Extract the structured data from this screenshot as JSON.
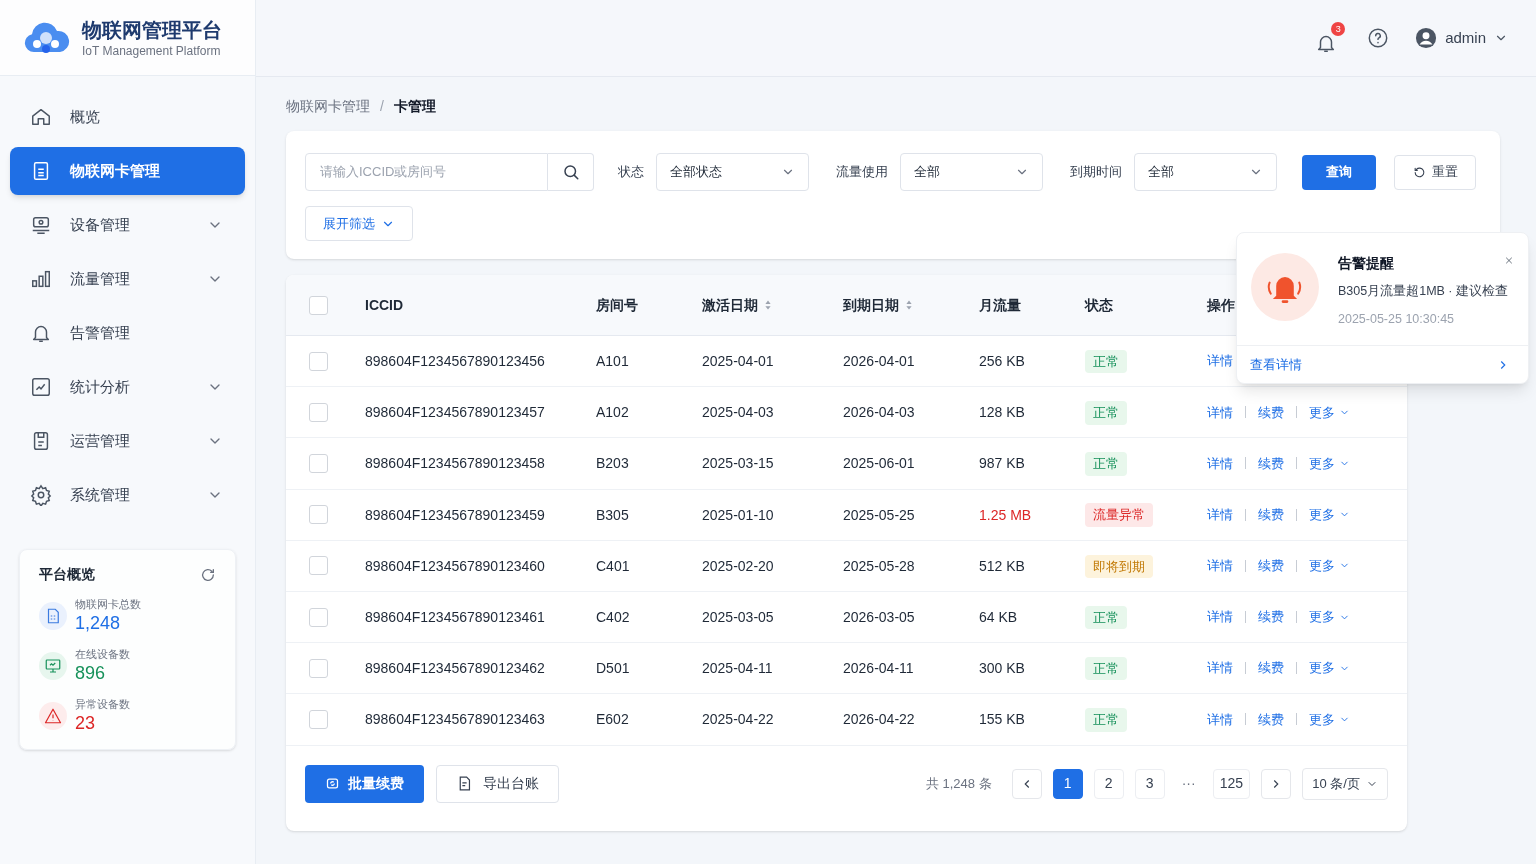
{
  "brand": {
    "title": "物联网管理平台",
    "subtitle": "IoT Management Platform"
  },
  "topbar": {
    "notification_count": "3",
    "user": "admin"
  },
  "sidebar": {
    "items": [
      {
        "label": "概览",
        "selected": false,
        "expandable": false
      },
      {
        "label": "物联网卡管理",
        "selected": true,
        "expandable": false
      },
      {
        "label": "设备管理",
        "selected": false,
        "expandable": true
      },
      {
        "label": "流量管理",
        "selected": false,
        "expandable": true
      },
      {
        "label": "告警管理",
        "selected": false,
        "expandable": false
      },
      {
        "label": "统计分析",
        "selected": false,
        "expandable": true
      },
      {
        "label": "运营管理",
        "selected": false,
        "expandable": true
      },
      {
        "label": "系统管理",
        "selected": false,
        "expandable": true
      }
    ]
  },
  "overview": {
    "title": "平台概览",
    "stats": [
      {
        "kind": "cards",
        "label": "物联网卡总数",
        "value": "1,248"
      },
      {
        "kind": "online",
        "label": "在线设备数",
        "value": "896"
      },
      {
        "kind": "abnormal",
        "label": "异常设备数",
        "value": "23"
      }
    ]
  },
  "breadcrumb": {
    "items": [
      "物联网卡管理",
      "卡管理"
    ],
    "separator": "/"
  },
  "filters": {
    "search_placeholder": "请输入ICCID或房间号",
    "selects": [
      {
        "label": "状态",
        "value": "全部状态"
      },
      {
        "label": "流量使用",
        "value": "全部"
      },
      {
        "label": "到期时间",
        "value": "全部"
      }
    ],
    "query_button": "查询",
    "reset_button": "重置",
    "expand_button": "展开筛选"
  },
  "table": {
    "header_checked": false,
    "columns": [
      {
        "label": "ICCID",
        "sortable": false
      },
      {
        "label": "房间号",
        "sortable": false
      },
      {
        "label": "激活日期",
        "sortable": true
      },
      {
        "label": "到期日期",
        "sortable": true
      },
      {
        "label": "月流量",
        "sortable": false
      },
      {
        "label": "状态",
        "sortable": false
      },
      {
        "label": "操作"
      }
    ],
    "rows": [
      {
        "checked": false,
        "iccid": "898604F1234567890123456",
        "room": "A101",
        "activated": "2025-04-01",
        "expires": "2026-04-01",
        "flow": "256 KB",
        "flow_alert": false,
        "status": {
          "label": "正常",
          "kind": "normal"
        },
        "actions": [
          {
            "label": "详情",
            "kind": "link"
          }
        ]
      },
      {
        "checked": false,
        "iccid": "898604F1234567890123457",
        "room": "A102",
        "activated": "2025-04-03",
        "expires": "2026-04-03",
        "flow": "128 KB",
        "flow_alert": false,
        "status": {
          "label": "正常",
          "kind": "normal"
        },
        "actions": [
          {
            "label": "详情",
            "kind": "link"
          },
          {
            "label": "续费",
            "kind": "link"
          },
          {
            "label": "更多",
            "kind": "menu"
          }
        ]
      },
      {
        "checked": false,
        "iccid": "898604F1234567890123458",
        "room": "B203",
        "activated": "2025-03-15",
        "expires": "2025-06-01",
        "flow": "987 KB",
        "flow_alert": false,
        "status": {
          "label": "正常",
          "kind": "normal"
        },
        "actions": [
          {
            "label": "详情",
            "kind": "link"
          },
          {
            "label": "续费",
            "kind": "link"
          },
          {
            "label": "更多",
            "kind": "menu"
          }
        ]
      },
      {
        "checked": false,
        "iccid": "898604F1234567890123459",
        "room": "B305",
        "activated": "2025-01-10",
        "expires": "2025-05-25",
        "flow": "1.25 MB",
        "flow_alert": true,
        "status": {
          "label": "流量异常",
          "kind": "abnormal"
        },
        "actions": [
          {
            "label": "详情",
            "kind": "link"
          },
          {
            "label": "续费",
            "kind": "link"
          },
          {
            "label": "更多",
            "kind": "menu"
          }
        ]
      },
      {
        "checked": false,
        "iccid": "898604F1234567890123460",
        "room": "C401",
        "activated": "2025-02-20",
        "expires": "2025-05-28",
        "flow": "512 KB",
        "flow_alert": false,
        "status": {
          "label": "即将到期",
          "kind": "expiring"
        },
        "actions": [
          {
            "label": "详情",
            "kind": "link"
          },
          {
            "label": "续费",
            "kind": "link"
          },
          {
            "label": "更多",
            "kind": "menu"
          }
        ]
      },
      {
        "checked": false,
        "iccid": "898604F1234567890123461",
        "room": "C402",
        "activated": "2025-03-05",
        "expires": "2026-03-05",
        "flow": "64 KB",
        "flow_alert": false,
        "status": {
          "label": "正常",
          "kind": "normal"
        },
        "actions": [
          {
            "label": "详情",
            "kind": "link"
          },
          {
            "label": "续费",
            "kind": "link"
          },
          {
            "label": "更多",
            "kind": "menu"
          }
        ]
      },
      {
        "checked": false,
        "iccid": "898604F1234567890123462",
        "room": "D501",
        "activated": "2025-04-11",
        "expires": "2026-04-11",
        "flow": "300 KB",
        "flow_alert": false,
        "status": {
          "label": "正常",
          "kind": "normal"
        },
        "actions": [
          {
            "label": "详情",
            "kind": "link"
          },
          {
            "label": "续费",
            "kind": "link"
          },
          {
            "label": "更多",
            "kind": "menu"
          }
        ]
      },
      {
        "checked": false,
        "iccid": "898604F1234567890123463",
        "room": "E602",
        "activated": "2025-04-22",
        "expires": "2026-04-22",
        "flow": "155 KB",
        "flow_alert": false,
        "status": {
          "label": "正常",
          "kind": "normal"
        },
        "actions": [
          {
            "label": "详情",
            "kind": "link"
          },
          {
            "label": "续费",
            "kind": "link"
          },
          {
            "label": "更多",
            "kind": "menu"
          }
        ]
      }
    ]
  },
  "footer": {
    "batch_button": "批量续费",
    "export_button": "导出台账",
    "total": "共 1,248 条",
    "pages": [
      {
        "kind": "page",
        "label": "1",
        "selected": true
      },
      {
        "kind": "page",
        "label": "2",
        "selected": false
      },
      {
        "kind": "page",
        "label": "3",
        "selected": false
      },
      {
        "kind": "ellipsis",
        "label": "···"
      },
      {
        "kind": "page",
        "label": "125",
        "selected": false
      }
    ],
    "page_size": "10 条/页"
  },
  "alert": {
    "title": "告警提醒",
    "message": "B305月流量超1MB · 建议检查",
    "time": "2025-05-25 10:30:45",
    "link": "查看详情"
  }
}
